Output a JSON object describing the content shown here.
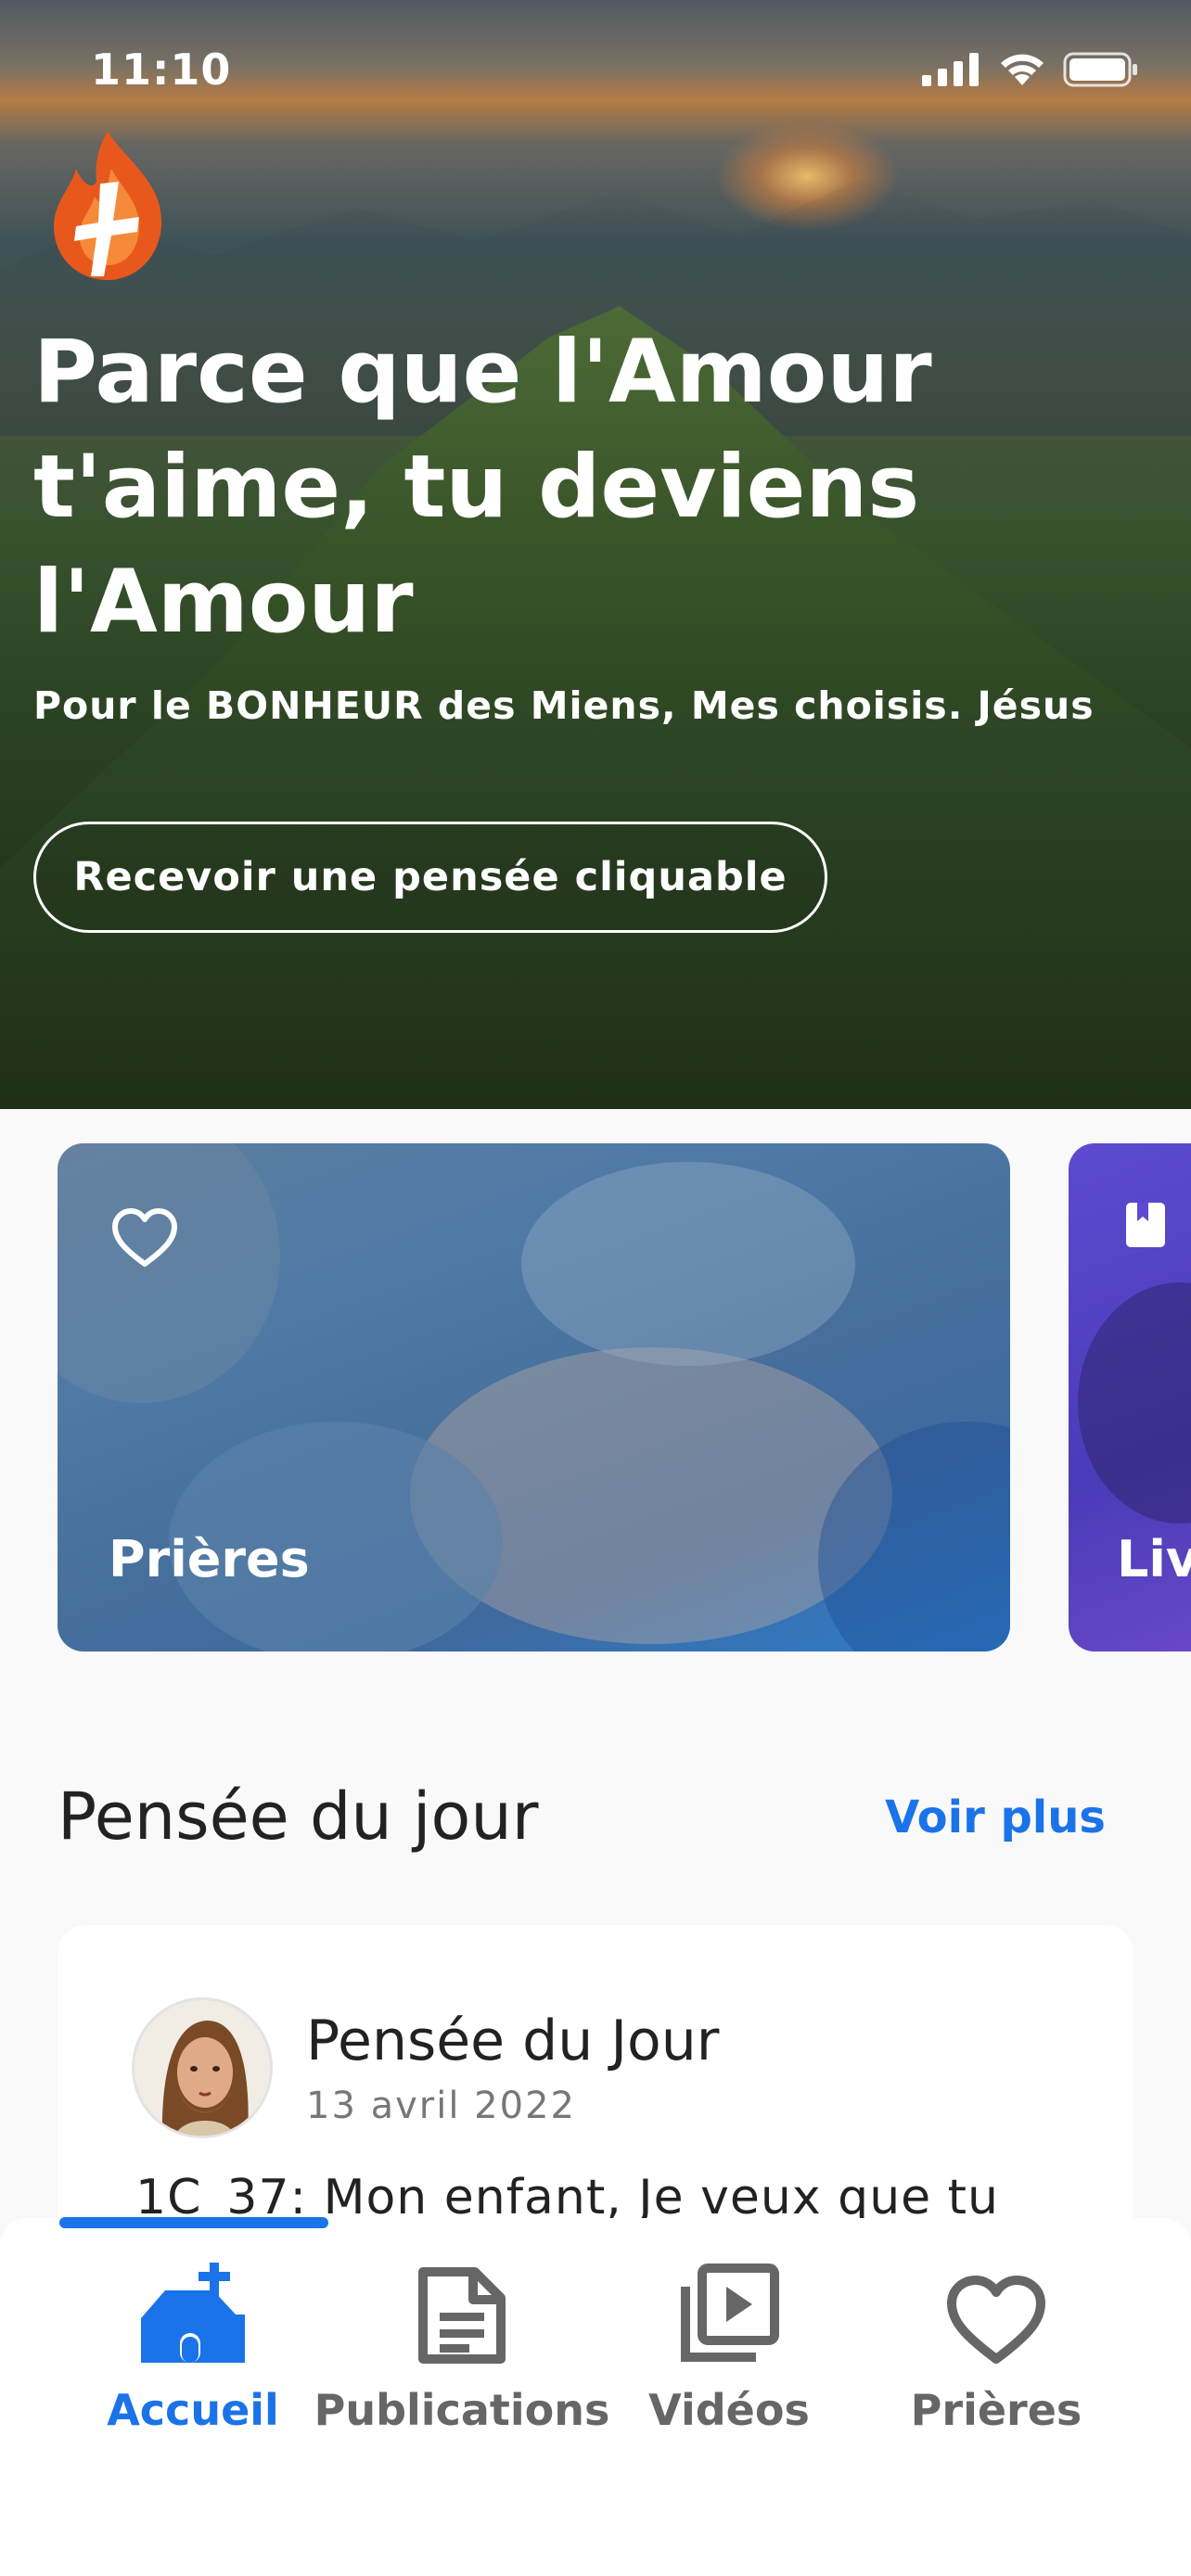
{
  "status_bar": {
    "time": "11:10"
  },
  "hero": {
    "title": "Parce que l'Amour t'aime, tu deviens l'Amour",
    "subtitle": "Pour le BONHEUR des Miens, Mes choisis. Jésus",
    "button_label": "Recevoir une pensée cliquable"
  },
  "categories": [
    {
      "label": "Prières",
      "icon": "heart-icon"
    },
    {
      "label": "Liv",
      "icon": "book-icon"
    }
  ],
  "section": {
    "title": "Pensée du jour",
    "see_more": "Voir plus"
  },
  "thought": {
    "title": "Pensée du Jour",
    "date": "13 avril 2022",
    "text": "1C_37: Mon enfant, Je veux que tu"
  },
  "tabs": [
    {
      "label": "Accueil",
      "icon": "church-icon",
      "active": true
    },
    {
      "label": "Publications",
      "icon": "document-icon",
      "active": false
    },
    {
      "label": "Vidéos",
      "icon": "video-library-icon",
      "active": false
    },
    {
      "label": "Prières",
      "icon": "heart-icon",
      "active": false
    }
  ],
  "colors": {
    "accent": "#1a73e8",
    "inactive": "#666666"
  }
}
